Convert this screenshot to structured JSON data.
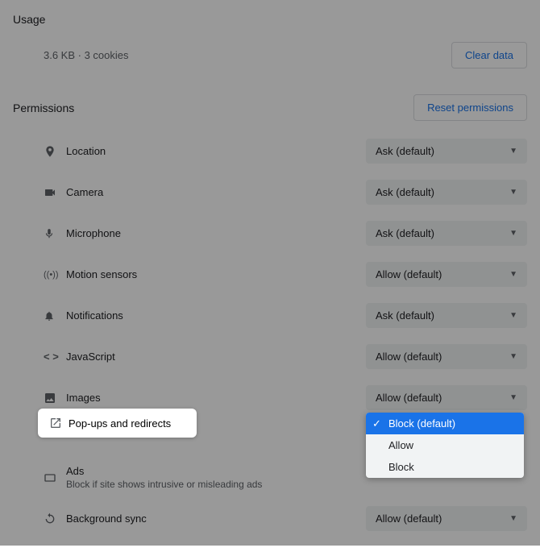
{
  "usage": {
    "title": "Usage",
    "text": "3.6 KB · 3 cookies",
    "clear_button": "Clear data"
  },
  "permissions": {
    "title": "Permissions",
    "reset_button": "Reset permissions",
    "items": [
      {
        "label": "Location",
        "value": "Ask (default)"
      },
      {
        "label": "Camera",
        "value": "Ask (default)"
      },
      {
        "label": "Microphone",
        "value": "Ask (default)"
      },
      {
        "label": "Motion sensors",
        "value": "Allow (default)"
      },
      {
        "label": "Notifications",
        "value": "Ask (default)"
      },
      {
        "label": "JavaScript",
        "value": "Allow (default)"
      },
      {
        "label": "Images",
        "value": "Allow (default)"
      },
      {
        "label": "Pop-ups and redirects",
        "value": "Block (default)"
      },
      {
        "label": "Ads",
        "sub": "Block if site shows intrusive or misleading ads",
        "value": ""
      },
      {
        "label": "Background sync",
        "value": "Allow (default)"
      }
    ]
  },
  "dropdown": {
    "options": [
      "Block (default)",
      "Allow",
      "Block"
    ],
    "selected": "Block (default)"
  }
}
